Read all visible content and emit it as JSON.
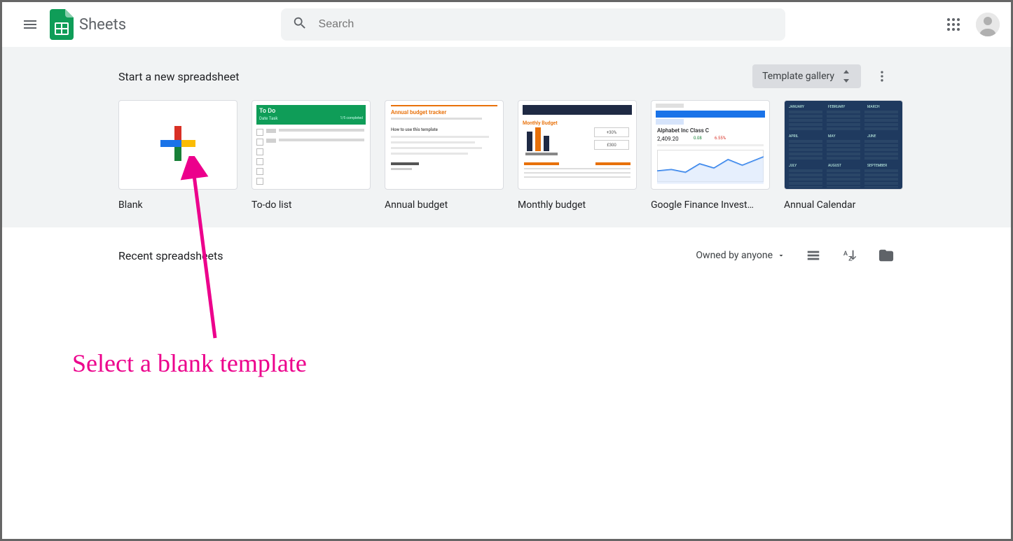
{
  "header": {
    "app_title": "Sheets",
    "search_placeholder": "Search"
  },
  "templates": {
    "section_title": "Start a new spreadsheet",
    "gallery_label": "Template gallery",
    "items": [
      {
        "label": "Blank"
      },
      {
        "label": "To-do list"
      },
      {
        "label": "Annual budget"
      },
      {
        "label": "Monthly budget"
      },
      {
        "label": "Google Finance Invest…"
      },
      {
        "label": "Annual Calendar"
      }
    ],
    "finance_thumb": {
      "title": "Alphabet Inc Class C",
      "price": "2,409.20",
      "change1": "0.08",
      "change2": "6.55%"
    },
    "annual_budget_thumb": {
      "title": "Annual budget tracker",
      "sub": "How to use this template"
    },
    "monthly_budget_thumb": {
      "title": "Monthly Budget",
      "badge1": "+30%",
      "badge2": "£300"
    },
    "todo_thumb": {
      "title": "To Do",
      "cols": "Date  Task",
      "status": "1/5 completed"
    },
    "calendar_thumb": {
      "months": [
        "JANUARY",
        "FEBRUARY",
        "MARCH",
        "APRIL",
        "MAY",
        "JUNE",
        "JULY",
        "AUGUST",
        "SEPTEMBER"
      ]
    }
  },
  "recent": {
    "section_title": "Recent spreadsheets",
    "owned_filter": "Owned by anyone"
  },
  "annotation": {
    "text": "Select a blank template"
  }
}
